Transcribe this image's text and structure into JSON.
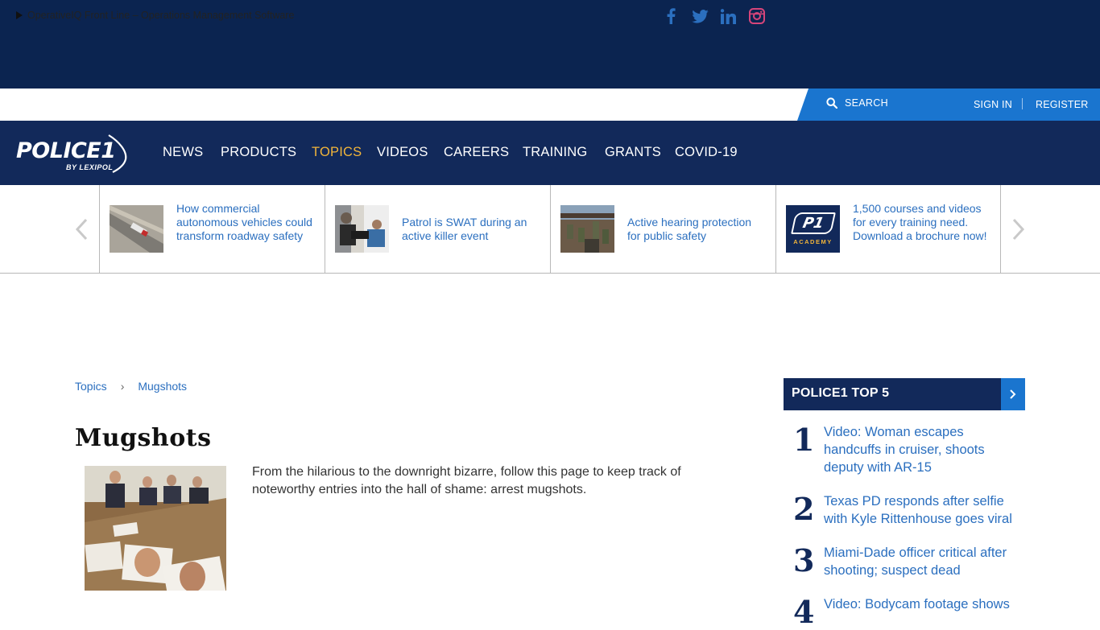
{
  "utility": {
    "promo_text": "OperativeIQ Front Line – Operations Management Software",
    "search_label": "SEARCH",
    "sign_in": "SIGN IN",
    "register": "REGISTER"
  },
  "social_icons": [
    "facebook-icon",
    "twitter-icon",
    "linkedin-icon",
    "instagram-icon"
  ],
  "logo": {
    "wordmark": "POLICE1",
    "tagline": "BY LEXIPOL"
  },
  "nav": {
    "items": [
      {
        "label": "NEWS"
      },
      {
        "label": "PRODUCTS"
      },
      {
        "label": "TOPICS",
        "active": true
      },
      {
        "label": "VIDEOS"
      },
      {
        "label": "CAREERS"
      },
      {
        "label": "TRAINING"
      },
      {
        "label": "GRANTS"
      },
      {
        "label": "COVID-19"
      }
    ]
  },
  "carousel": {
    "items": [
      {
        "text": "How commercial autonomous vehicles could transform roadway safety"
      },
      {
        "text": "Patrol is SWAT during an active killer event"
      },
      {
        "text": "Active hearing protection for public safety"
      },
      {
        "text": "1,500 courses and videos for every training need. Download a brochure now!",
        "badge_top": "P1",
        "badge_bottom": "ACADEMY"
      }
    ]
  },
  "breadcrumb": {
    "items": [
      "Topics",
      "Mugshots"
    ],
    "separator": "›"
  },
  "page": {
    "title": "Mugshots",
    "description": "From the hilarious to the downright bizarre, follow this page to keep track of noteworthy entries into the hall of shame: arrest mugshots."
  },
  "top5": {
    "title": "POLICE1 TOP 5",
    "items": [
      {
        "rank": "1",
        "text": "Video: Woman escapes handcuffs in cruiser, shoots deputy with AR-15"
      },
      {
        "rank": "2",
        "text": "Texas PD responds after selfie with Kyle Rittenhouse goes viral"
      },
      {
        "rank": "3",
        "text": "Miami-Dade officer critical after shooting; suspect dead"
      },
      {
        "rank": "4",
        "text": "Video: Bodycam footage shows"
      }
    ]
  },
  "colors": {
    "navy": "#12295a",
    "banner": "#0b2450",
    "accent_blue": "#1a75cf",
    "link_blue": "#2b6fbf",
    "active_nav": "#f2b53a"
  }
}
